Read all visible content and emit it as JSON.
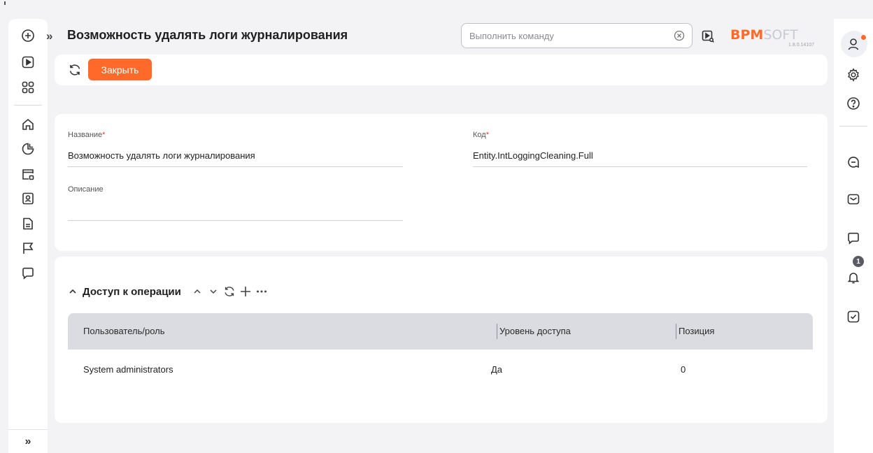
{
  "header": {
    "title": "Возможность удалять логи журналирования",
    "command_placeholder": "Выполнить команду",
    "logo": {
      "brand": "BPM",
      "suffix": "SOFT",
      "version": "1.8.0.14107"
    }
  },
  "toolbar": {
    "close_label": "Закрыть"
  },
  "form": {
    "name_label": "Название",
    "name_value": "Возможность удалять логи журналирования",
    "code_label": "Код",
    "code_value": "Entity.IntLoggingCleaning.Full",
    "description_label": "Описание",
    "description_value": "",
    "required_mark": "*"
  },
  "access": {
    "title": "Доступ к операции",
    "columns": [
      "Пользователь/роль",
      "Уровень доступа",
      "Позиция"
    ],
    "rows": [
      {
        "user": "System administrators",
        "level": "Да",
        "position": "0"
      }
    ]
  },
  "notifications": {
    "count": "1"
  },
  "colors": {
    "accent": "#ff6a2b",
    "required": "#e53935",
    "grid_header": "#dbdce1"
  }
}
